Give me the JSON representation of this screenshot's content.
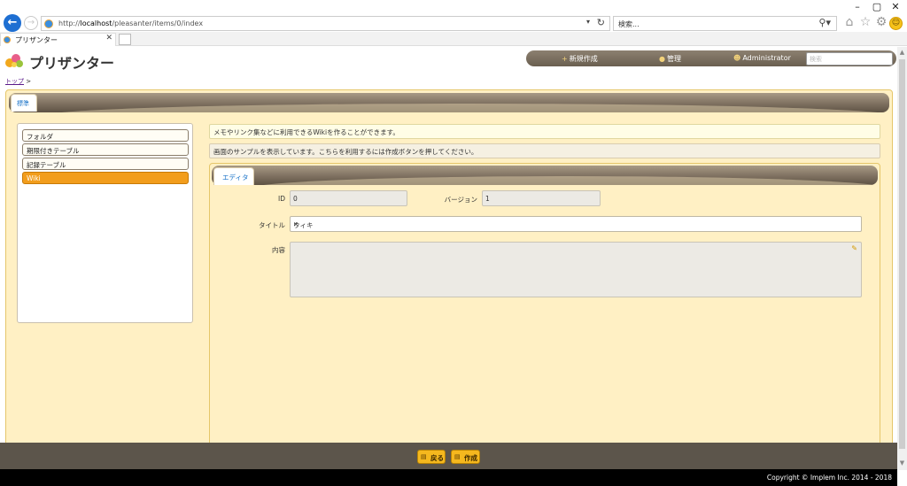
{
  "browser": {
    "url_prefix": "http://",
    "url_host": "localhost",
    "url_path": "/pleasanter/items/0/index",
    "search_placeholder": "検索...",
    "tab_title": "プリザンター",
    "window_controls": [
      "–",
      "▢",
      "✕"
    ]
  },
  "header": {
    "logo_text": "プリザンター",
    "nav": [
      {
        "label": "新規作成",
        "icon": "plus-icon"
      },
      {
        "label": "管理",
        "icon": "gear-icon"
      },
      {
        "label": "Administrator",
        "icon": "user-icon"
      }
    ],
    "search_placeholder": "検索"
  },
  "breadcrumb": {
    "home": "トップ",
    "sep": ">"
  },
  "main_tab": "標準",
  "sidebar": {
    "items": [
      {
        "label": "フォルダ",
        "active": false
      },
      {
        "label": "期限付きテーブル",
        "active": false
      },
      {
        "label": "記録テーブル",
        "active": false
      },
      {
        "label": "Wiki",
        "active": true
      }
    ]
  },
  "info": {
    "line1": "メモやリンク集などに利用できるWikiを作ることができます。",
    "line2": "画面のサンプルを表示しています。こちらを利用するには作成ボタンを押してください。"
  },
  "editor": {
    "tab": "エディタ",
    "id_label": "ID",
    "id_value": "0",
    "version_label": "バージョン",
    "version_value": "1",
    "title_label": "タイトル",
    "title_value": "ウィキ",
    "content_label": "内容",
    "content_value": ""
  },
  "footer": {
    "back": "戻る",
    "create": "作成",
    "copyright": "Copyright © Implem Inc. 2014 - 2018"
  },
  "colors": {
    "accent": "#f29d1c",
    "panel_bg": "#fff0c4",
    "bar_dark": "#6a5f50",
    "link_blue": "#1a73c8"
  }
}
